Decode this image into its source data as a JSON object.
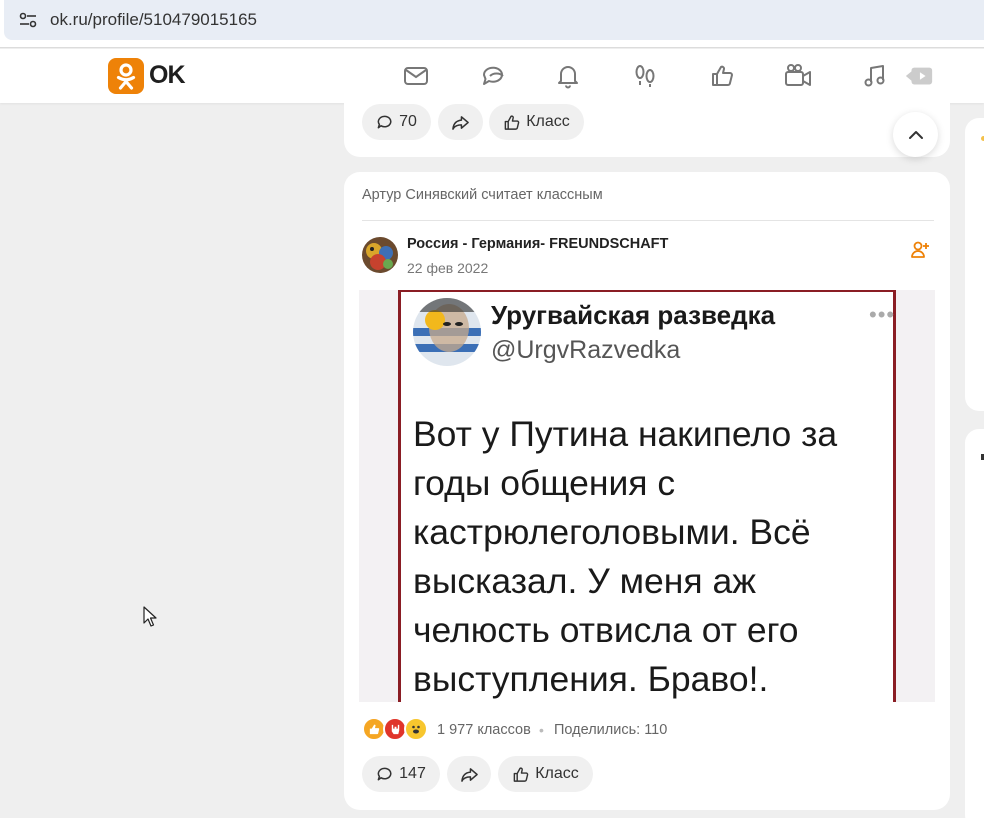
{
  "browser": {
    "url": "ok.ru/profile/510479015165",
    "site_info_icon": "tune-icon"
  },
  "header": {
    "logo_text": "OK",
    "brand_color": "#ee8208",
    "nav_icons": [
      "messages-icon",
      "discussions-icon",
      "notifications-icon",
      "guests-icon",
      "likes-icon",
      "video-icon",
      "music-icon",
      "live-video-icon"
    ]
  },
  "previous_post": {
    "comments_count": "70",
    "share_icon": "share-icon",
    "klass_label": "Класс"
  },
  "post": {
    "liked_by": "Артур Синявский считает классным",
    "group_name": "Россия - Германия- FREUNDSCHAFT",
    "date": "22 фев 2022",
    "join_icon": "add-friend-icon",
    "image": {
      "tweet_name": "Уругвайская разведка",
      "tweet_handle": "@UrgvRazvedka",
      "tweet_dots": "•••",
      "tweet_text": "Вот у Путина накипело за годы общения с кастрюлеголовыми. Всё высказал. У меня аж челюсть отвисла от его выступления. Браво!.",
      "frame_color": "#8a1d24"
    },
    "reactions": [
      "like-reaction",
      "rock-reaction",
      "laugh-reaction"
    ],
    "klass_count": "1 977 классов",
    "separator": "•",
    "shares": "Поделились: 110",
    "comments_count": "147",
    "klass_label": "Класс"
  }
}
